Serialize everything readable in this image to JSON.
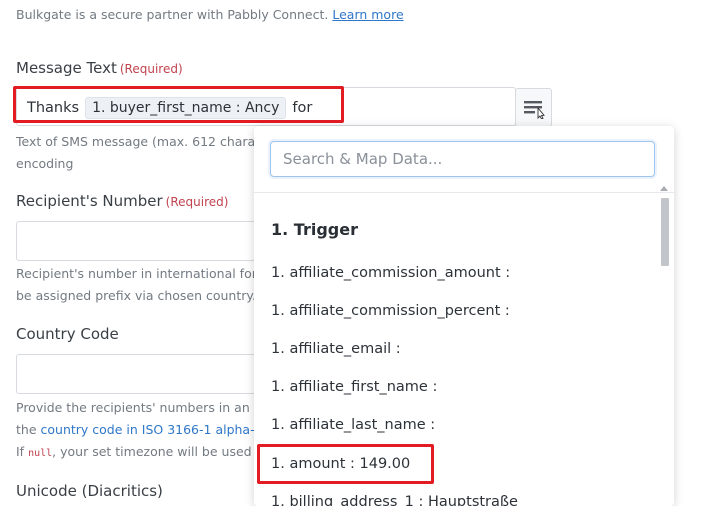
{
  "intro": {
    "text": "Bulkgate is a secure partner with Pabbly Connect.",
    "link": "Learn more"
  },
  "message_text": {
    "label": "Message Text",
    "required": "(Required)",
    "prefix": "Thanks",
    "token": "1. buyer_first_name : Ancy",
    "suffix": "for",
    "help_line1": "Text of SMS message (max. 612 characters",
    "help_line2": "encoding"
  },
  "recipient": {
    "label": "Recipient's Number",
    "required": "(Required)",
    "value": "",
    "help_line1": "Recipient's number in international format",
    "help_line2": "be assigned prefix via chosen country."
  },
  "country_code": {
    "label": "Country Code",
    "value": "",
    "help_line1": "Provide the recipients' numbers in an inter",
    "help_line2_pre": "the",
    "help_line2_link": "country code in ISO 3166-1 alpha-2 fo",
    "help_line3_pre": "If",
    "help_line3_code": "null",
    "help_line3_post": ", your set timezone will be used to f"
  },
  "unicode": {
    "label": "Unicode (Diacritics)"
  },
  "dropdown": {
    "search_placeholder": "Search & Map Data...",
    "group": "1. Trigger",
    "items": [
      "1. affiliate_commission_amount :",
      "1. affiliate_commission_percent :",
      "1. affiliate_email :",
      "1. affiliate_first_name :",
      "1. affiliate_last_name :",
      "1. amount : 149.00",
      "1. billing_address_1 : Hauptstraße"
    ]
  },
  "colors": {
    "highlight_border": "#e31b23",
    "link": "#2f77c9",
    "required": "#c0434f"
  }
}
